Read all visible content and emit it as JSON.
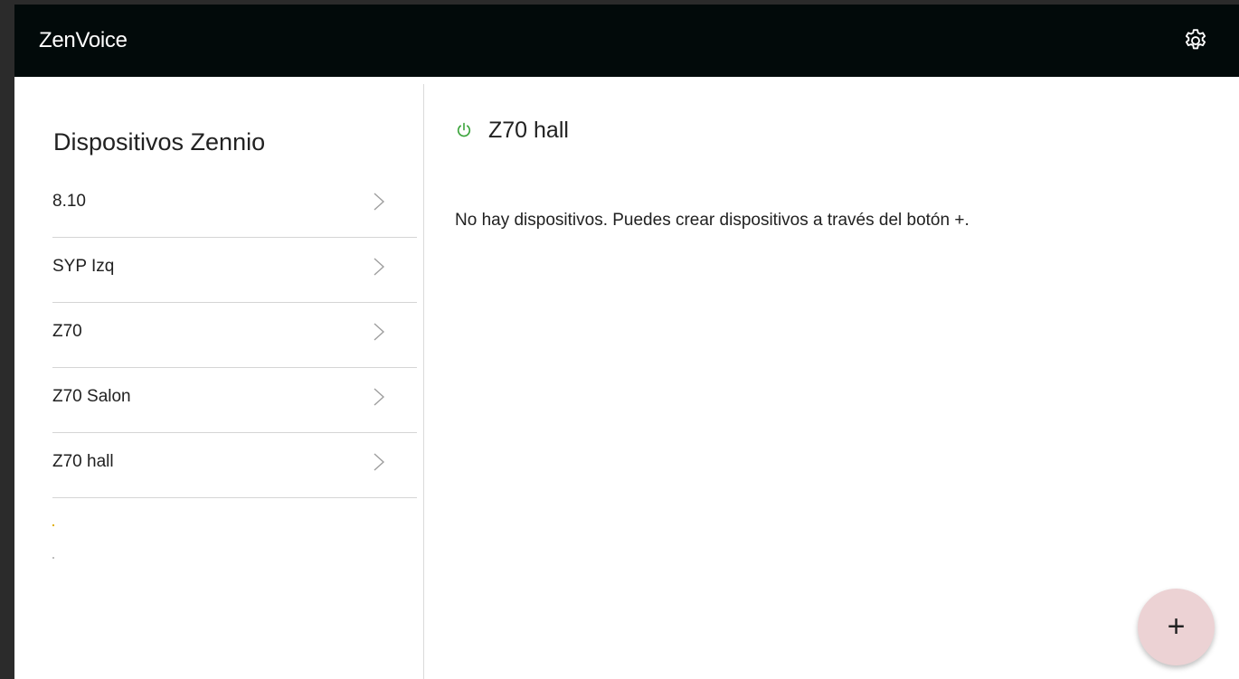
{
  "app": {
    "title": "ZenVoice"
  },
  "sidebar": {
    "title": "Dispositivos Zennio",
    "items": [
      {
        "label": "8.10"
      },
      {
        "label": "SYP Izq"
      },
      {
        "label": "Z70"
      },
      {
        "label": "Z70 Salon"
      },
      {
        "label": "Z70 hall"
      }
    ]
  },
  "main": {
    "title": "Z70 hall",
    "empty_message": "No hay dispositivos. Puedes crear dispositivos a través del botón +."
  },
  "fab": {
    "label": "+"
  },
  "icons": {
    "settings": "gear-icon",
    "power": "power-icon",
    "chevron": "chevron-right-icon"
  },
  "colors": {
    "appbar_bg": "#020a0a",
    "power_green": "#3aa33a",
    "fab_bg": "#ecd2d4"
  }
}
